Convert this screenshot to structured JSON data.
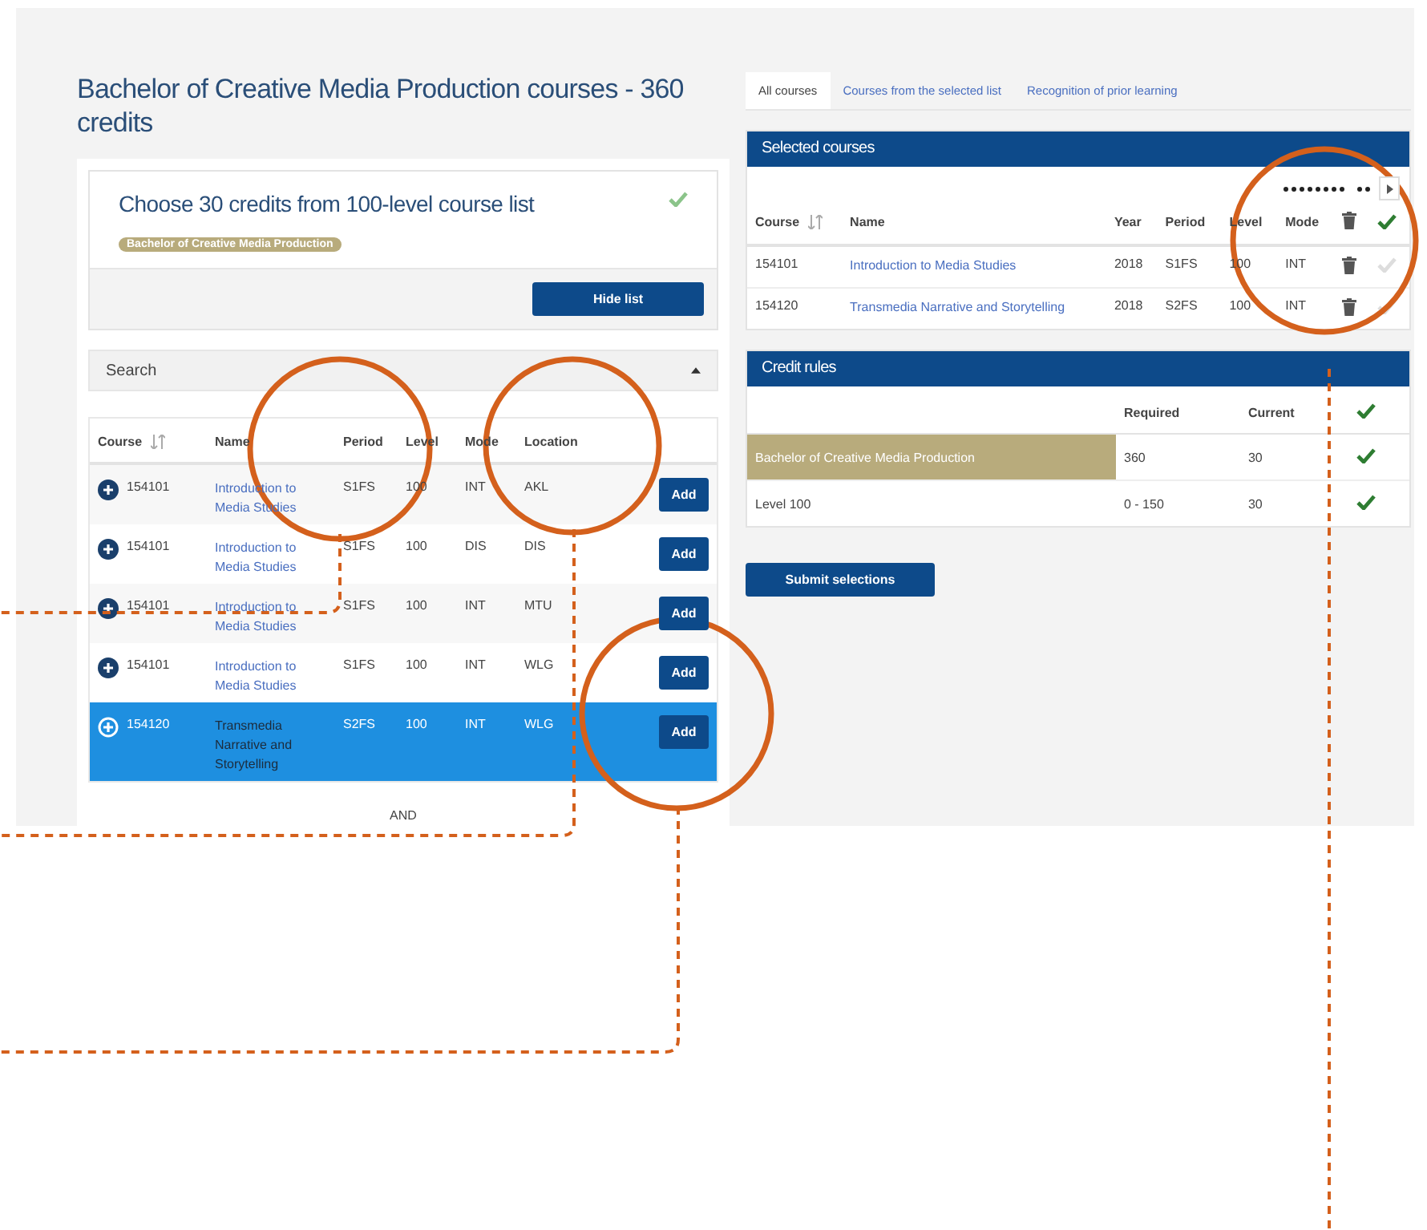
{
  "page": {
    "title": "Bachelor of Creative Media Production courses - 360 credits"
  },
  "requirement": {
    "heading": "Choose 30 credits from 100-level course list",
    "badge": "Bachelor of Creative Media Production",
    "complete": true,
    "button": "Hide list"
  },
  "search": {
    "label": "Search",
    "expanded": true
  },
  "course_list": {
    "columns": [
      "Course",
      "Name",
      "Period",
      "Level",
      "Mode",
      "Location"
    ],
    "rows": [
      {
        "course": "154101",
        "name": "Introduction to Media Studies",
        "period": "S1FS",
        "level": "100",
        "mode": "INT",
        "location": "AKL",
        "action": "Add",
        "selected": false
      },
      {
        "course": "154101",
        "name": "Introduction to Media Studies",
        "period": "S1FS",
        "level": "100",
        "mode": "DIS",
        "location": "DIS",
        "action": "Add",
        "selected": false
      },
      {
        "course": "154101",
        "name": "Introduction to Media Studies",
        "period": "S1FS",
        "level": "100",
        "mode": "INT",
        "location": "MTU",
        "action": "Add",
        "selected": false
      },
      {
        "course": "154101",
        "name": "Introduction to Media Studies",
        "period": "S1FS",
        "level": "100",
        "mode": "INT",
        "location": "WLG",
        "action": "Add",
        "selected": false
      },
      {
        "course": "154120",
        "name": "Transmedia Narrative and Storytelling",
        "period": "S2FS",
        "level": "100",
        "mode": "INT",
        "location": "WLG",
        "action": "Add",
        "selected": true
      }
    ],
    "footer": "AND"
  },
  "tabs": [
    {
      "label": "All courses",
      "selected": true
    },
    {
      "label": "Courses from the selected list",
      "selected": false
    },
    {
      "label": "Recognition of prior learning",
      "selected": false
    }
  ],
  "selected_courses": {
    "title": "Selected courses",
    "columns": [
      "Course",
      "Name",
      "Year",
      "Period",
      "Level",
      "Mode"
    ],
    "rows": [
      {
        "course": "154101",
        "name": "Introduction to Media Studies",
        "year": "2018",
        "period": "S1FS",
        "level": "100",
        "mode": "INT",
        "confirmed": false
      },
      {
        "course": "154120",
        "name": "Transmedia Narrative and Storytelling",
        "year": "2018",
        "period": "S2FS",
        "level": "100",
        "mode": "INT",
        "confirmed": false
      }
    ]
  },
  "credit_rules": {
    "title": "Credit rules",
    "columns": [
      "Required",
      "Current"
    ],
    "rows": [
      {
        "name": "Bachelor of Creative Media Production",
        "required": "360",
        "current": "30",
        "met": true,
        "highlighted": true
      },
      {
        "name": "Level 100",
        "required": "0 - 150",
        "current": "30",
        "met": true,
        "highlighted": false
      }
    ]
  },
  "submit": {
    "label": "Submit selections"
  }
}
